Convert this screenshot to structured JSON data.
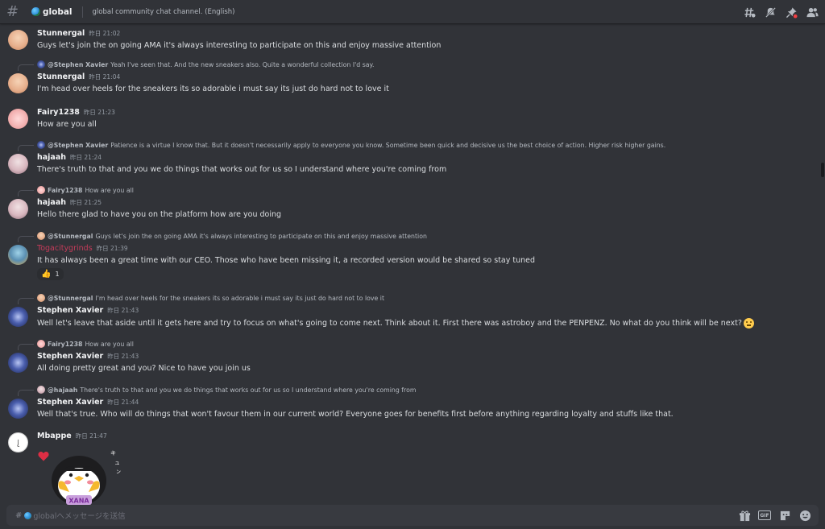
{
  "header": {
    "channel_name": "global",
    "topic": "global community chat channel. (English)",
    "icons": [
      "threads-icon",
      "mute-icon",
      "pin-icon",
      "members-icon"
    ]
  },
  "messages": [
    {
      "author": "Stunnergal",
      "timestamp": "昨日 21:02",
      "text": "Guys let's join the on going AMA it's always interesting to participate on this and enjoy massive attention"
    },
    {
      "reply_to": "@Stephen Xavier",
      "reply_text": "Yeah I've seen that. And the new sneakers also. Quite a wonderful collection I'd say.",
      "author": "Stunnergal",
      "timestamp": "昨日 21:04",
      "text": "I'm head over heels for the sneakers its so adorable i must say its just do hard not to love it"
    },
    {
      "author": "Fairy1238",
      "timestamp": "昨日 21:23",
      "text": "How are you all"
    },
    {
      "reply_to": "@Stephen Xavier",
      "reply_text": "Patience is a virtue I know that. But it doesn't necessarily apply to everyone you know. Sometime been quick and decisive us the best choice of action. Higher risk higher gains.",
      "author": "hajaah",
      "timestamp": "昨日 21:24",
      "text": "There's truth to that and you we do things that works out for us so I understand where you're coming from"
    },
    {
      "reply_to": "Fairy1238",
      "reply_text": "How are you all",
      "author": "hajaah",
      "timestamp": "昨日 21:25",
      "text": "Hello there glad to have you on the platform how are you doing"
    },
    {
      "reply_to": "@Stunnergal",
      "reply_text": "Guys let's join the on going AMA it's always interesting to participate on this and enjoy massive attention",
      "author": "Togacitygrinds",
      "timestamp": "昨日 21:39",
      "text": "It has always been a great time with our CEO. Those who have been missing it, a recorded version would be shared so stay tuned",
      "reaction_count": "1"
    },
    {
      "reply_to": "@Stunnergal",
      "reply_text": "I'm head over heels for the sneakers its so adorable i must say its just do hard not to love it",
      "author": "Stephen Xavier",
      "timestamp": "昨日 21:43",
      "text": "Well let's leave that aside until it gets here and try to focus on what's going to come next. Think about it. First there was astroboy and the PENPENZ. No what do you think will be next?"
    },
    {
      "reply_to": "Fairy1238",
      "reply_text": "How are you all",
      "author": "Stephen Xavier",
      "timestamp": "昨日 21:43",
      "text": "All doing pretty great and you? Nice to have you join us"
    },
    {
      "reply_to": "@hajaah",
      "reply_text": "There's truth to that and you we do things that works out for us so I understand where you're coming from",
      "author": "Stephen Xavier",
      "timestamp": "昨日 21:44",
      "text": "Well that's true. Who will do things that won't favour them in our current world? Everyone goes for benefits first before anything regarding loyalty and stuffs like that."
    },
    {
      "author": "Mbappe",
      "timestamp": "昨日 21:47",
      "sticker_text": "XANA"
    }
  ],
  "input": {
    "placeholder": "globalへメッセージを送信",
    "icons": [
      "gift-icon",
      "gif-icon",
      "sticker-icon",
      "emoji-icon"
    ],
    "gif_label": "GIF"
  },
  "colors": {
    "background": "#313338",
    "input": "#383a40",
    "togacity_name": "#c53b5a"
  }
}
